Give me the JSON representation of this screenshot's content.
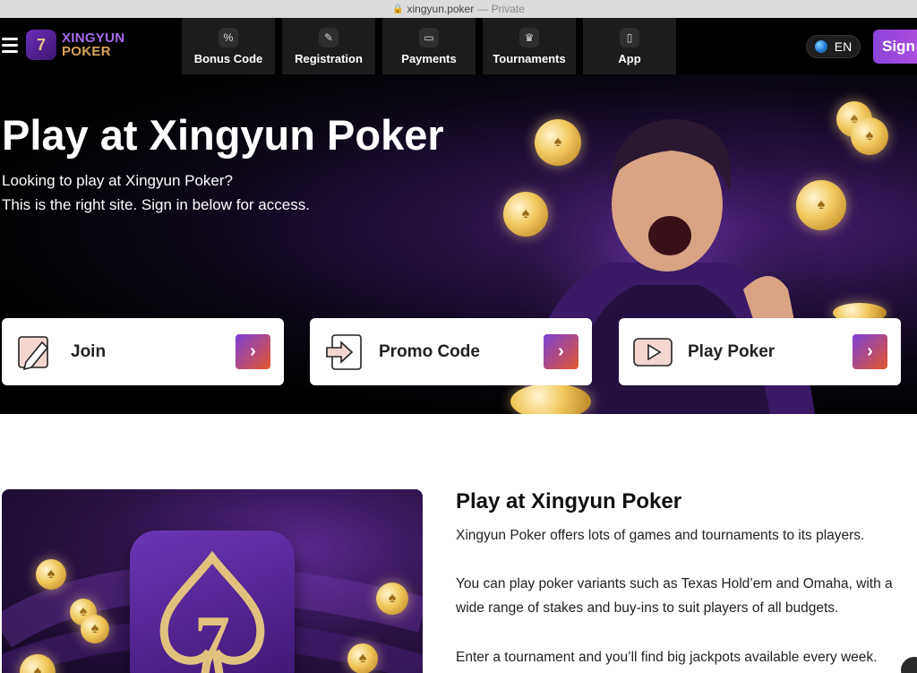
{
  "browser": {
    "url": "xingyun.poker",
    "private_label": "— Private"
  },
  "header": {
    "logo_line1": "XINGYUN",
    "logo_line2": "POKER",
    "nav": [
      {
        "label": "Bonus Code",
        "icon": "percent-icon"
      },
      {
        "label": "Registration",
        "icon": "user-edit-icon"
      },
      {
        "label": "Payments",
        "icon": "card-icon"
      },
      {
        "label": "Tournaments",
        "icon": "trophy-icon"
      },
      {
        "label": "App",
        "icon": "phone-icon"
      }
    ],
    "language": "EN",
    "signin_label": "Sign i"
  },
  "hero": {
    "title": "Play at Xingyun Poker",
    "subtitle_line1": "Looking to play at Xingyun Poker?",
    "subtitle_line2": "This is the right site. Sign in below for access.",
    "cards": [
      {
        "label": "Join",
        "icon": "edit-icon"
      },
      {
        "label": "Promo Code",
        "icon": "enter-icon"
      },
      {
        "label": "Play Poker",
        "icon": "play-icon"
      }
    ]
  },
  "content": {
    "title": "Play at Xingyun Poker",
    "p1": "Xingyun Poker offers lots of games and tournaments to its players.",
    "p2": "You can play poker variants such as Texas Hold’em and Omaha, with a wide range of stakes and buy-ins to suit players of all budgets.",
    "p3": "Enter a tournament and you’ll find big jackpots available every week."
  },
  "colors": {
    "accent_purple": "#8e44d9",
    "accent_orange": "#e4572e",
    "gold": "#d9a45a"
  }
}
